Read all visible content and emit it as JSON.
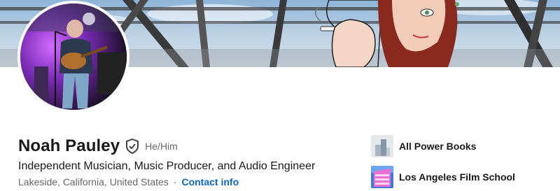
{
  "profile": {
    "name": "Noah Pauley",
    "pronouns": "He/Him",
    "headline": "Independent Musician, Music Producer, and Audio Engineer",
    "location": "Lakeside, California, United States",
    "separator": "·",
    "contact_label": "Contact info"
  },
  "organizations": [
    {
      "name": "All Power Books",
      "logo_icon": "all-power-books-logo"
    },
    {
      "name": "Los Angeles Film School",
      "logo_icon": "la-film-school-logo"
    }
  ],
  "colors": {
    "link": "#0a66c2",
    "text_primary": "#191919",
    "text_secondary": "#666666"
  }
}
